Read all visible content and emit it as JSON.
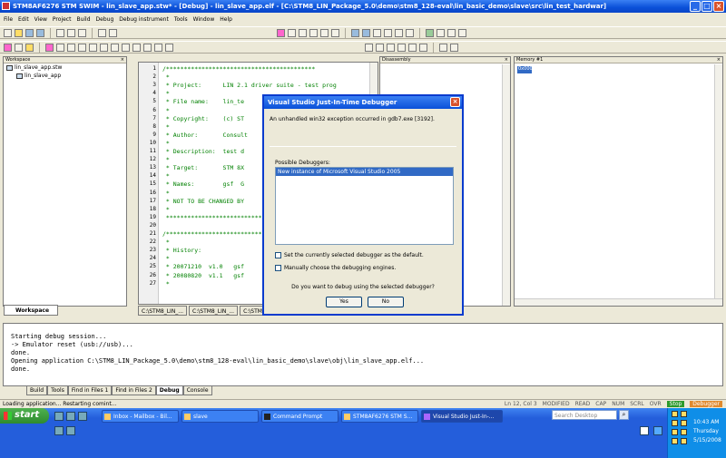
{
  "window": {
    "title": "STM8AF6276 STM SWIM - lin_slave_app.stw* - [Debug] - lin_slave_app.elf - [C:\\STM8_LIN_Package_5.0\\demo\\stm8_128-eval\\lin_basic_demo\\slave\\src\\lin_test_hardwar]",
    "min_label": "_",
    "max_label": "□",
    "close_label": "×"
  },
  "menu": [
    "File",
    "Edit",
    "View",
    "Project",
    "Build",
    "Debug",
    "Debug instrument",
    "Tools",
    "Window",
    "Help"
  ],
  "workspace": {
    "title": "Workspace",
    "root": "lin_slave_app.stw",
    "child": "lin_slave_app",
    "tab": "Workspace"
  },
  "disassembly": {
    "title": "Disassembly"
  },
  "memory": {
    "title": "Memory #1",
    "address": "0x000"
  },
  "editor": {
    "lines": [
      "1",
      "2",
      "3",
      "4",
      "5",
      "6",
      "7",
      "8",
      "9",
      "10",
      "11",
      "12",
      "13",
      "14",
      "15",
      "16",
      "17",
      "18",
      "19",
      "20",
      "21",
      "22",
      "23",
      "24",
      "25",
      "26",
      "27"
    ],
    "code": [
      "/******************************************",
      " *",
      " * Project:      LIN 2.1 driver suite - test prog",
      " *",
      " * File name:    lin_te",
      " *",
      " * Copyright:    (c) ST",
      " *",
      " * Author:       Consult",
      " *",
      " * Description:  test d",
      " *",
      " * Target:       STM 8X",
      " *",
      " * Names:        gsf  G",
      " *",
      " * NOT TO BE CHANGED BY",
      " *",
      " ******************************************",
      "",
      "/******************************************",
      " *",
      " * History:",
      " *",
      " * 20071210  v1.0   gsf",
      " * 20080820  v1.1   gsf",
      " *"
    ],
    "tabs": [
      "C:\\STM8_LIN_...",
      "C:\\STM8_LIN_...",
      "C:\\STM8_LIN_..."
    ]
  },
  "output": {
    "lines": [
      "Starting debug session...",
      "-> Emulator reset (usb://usb)...",
      "done.",
      "Opening application C:\\STM8_LIN_Package_5.0\\demo\\stm8_128-eval\\lin_basic_demo\\slave\\obj\\lin_slave_app.elf...",
      "done."
    ],
    "tabs": [
      "Build",
      "Tools",
      "Find in Files 1",
      "Find in Files 2",
      "Debug",
      "Console"
    ]
  },
  "status": {
    "left": "Loading application... Restarting comint...",
    "position": "Ln 12, Col 3",
    "flags": [
      "MODIFIED",
      "READ",
      "CAP",
      "NUM",
      "SCRL",
      "OVR"
    ],
    "run": "Stop",
    "debug": "Debugger"
  },
  "dialog": {
    "title": "Visual Studio Just-In-Time Debugger",
    "message": "An unhandled win32 exception occurred in gdb7.exe [3192].",
    "list_label": "Possible Debuggers:",
    "list_item": "New instance of Microsoft Visual Studio 2005",
    "check1": "Set the currently selected debugger as the default.",
    "check2": "Manually choose the debugging engines.",
    "question": "Do you want to debug using the selected debugger?",
    "yes": "Yes",
    "no": "No",
    "close_label": "×"
  },
  "taskbar": {
    "start": "start",
    "tasks": [
      "Inbox - Mailbox - Bil...",
      "slave",
      "Command Prompt",
      "STM8AF6276 STM S...",
      "Visual Studio Just-In-..."
    ],
    "search_placeholder": "Search Desktop",
    "time": "10:43 AM",
    "day": "Thursday",
    "date": "5/15/2008"
  }
}
